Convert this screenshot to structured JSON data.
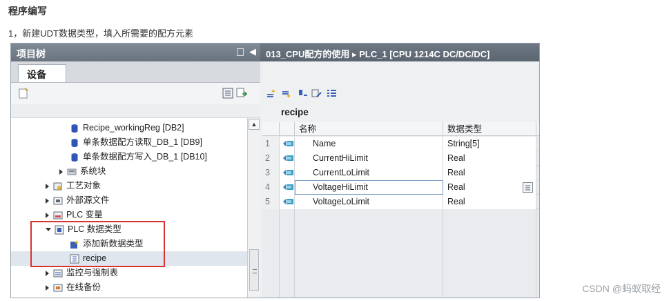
{
  "article": {
    "heading": "程序编写",
    "step": "1，新建UDT数据类型，填入所需要的配方元素",
    "watermark": "CSDN @蚂蚁取经"
  },
  "project_tree": {
    "title": "项目树",
    "tab_label": "设备",
    "items": [
      {
        "label": "Recipe_workingReg [DB2]",
        "icon": "database-icon",
        "expanded": null
      },
      {
        "label": "单条数据配方读取_DB_1 [DB9]",
        "icon": "database-icon",
        "expanded": null
      },
      {
        "label": "单条数据配方写入_DB_1 [DB10]",
        "icon": "database-icon",
        "expanded": null
      },
      {
        "label": "系统块",
        "icon": "system-block-icon",
        "expanded": false
      },
      {
        "label": "工艺对象",
        "icon": "technology-objects-icon",
        "expanded": false
      },
      {
        "label": "外部源文件",
        "icon": "external-source-icon",
        "expanded": false
      },
      {
        "label": "PLC 变量",
        "icon": "plc-tags-icon",
        "expanded": false
      },
      {
        "label": "PLC 数据类型",
        "icon": "plc-data-types-icon",
        "expanded": true
      },
      {
        "label": "添加新数据类型",
        "icon": "add-data-type-icon",
        "expanded": null
      },
      {
        "label": "recipe",
        "icon": "udt-icon",
        "expanded": null
      },
      {
        "label": "监控与强制表",
        "icon": "watch-table-icon",
        "expanded": false
      },
      {
        "label": "在线备份",
        "icon": "online-backup-icon",
        "expanded": false
      }
    ]
  },
  "editor": {
    "breadcrumb": "013_CPU配方的使用 ▸ PLC_1 [CPU 1214C DC/DC/DC]",
    "datatype_name": "recipe",
    "columns": {
      "name": "名称",
      "datatype": "数据类型"
    },
    "rows": [
      {
        "num": "1",
        "name": "Name",
        "type": "String[5]"
      },
      {
        "num": "2",
        "name": "CurrentHiLimit",
        "type": "Real"
      },
      {
        "num": "3",
        "name": "CurrentLoLimit",
        "type": "Real"
      },
      {
        "num": "4",
        "name": "VoltageHiLimit",
        "type": "Real"
      },
      {
        "num": "5",
        "name": "VoltageLoLimit",
        "type": "Real"
      }
    ]
  },
  "colors": {
    "highlight_box": "#d93030",
    "title_bar": "#6d7884",
    "selection": "#dfe6ee"
  }
}
